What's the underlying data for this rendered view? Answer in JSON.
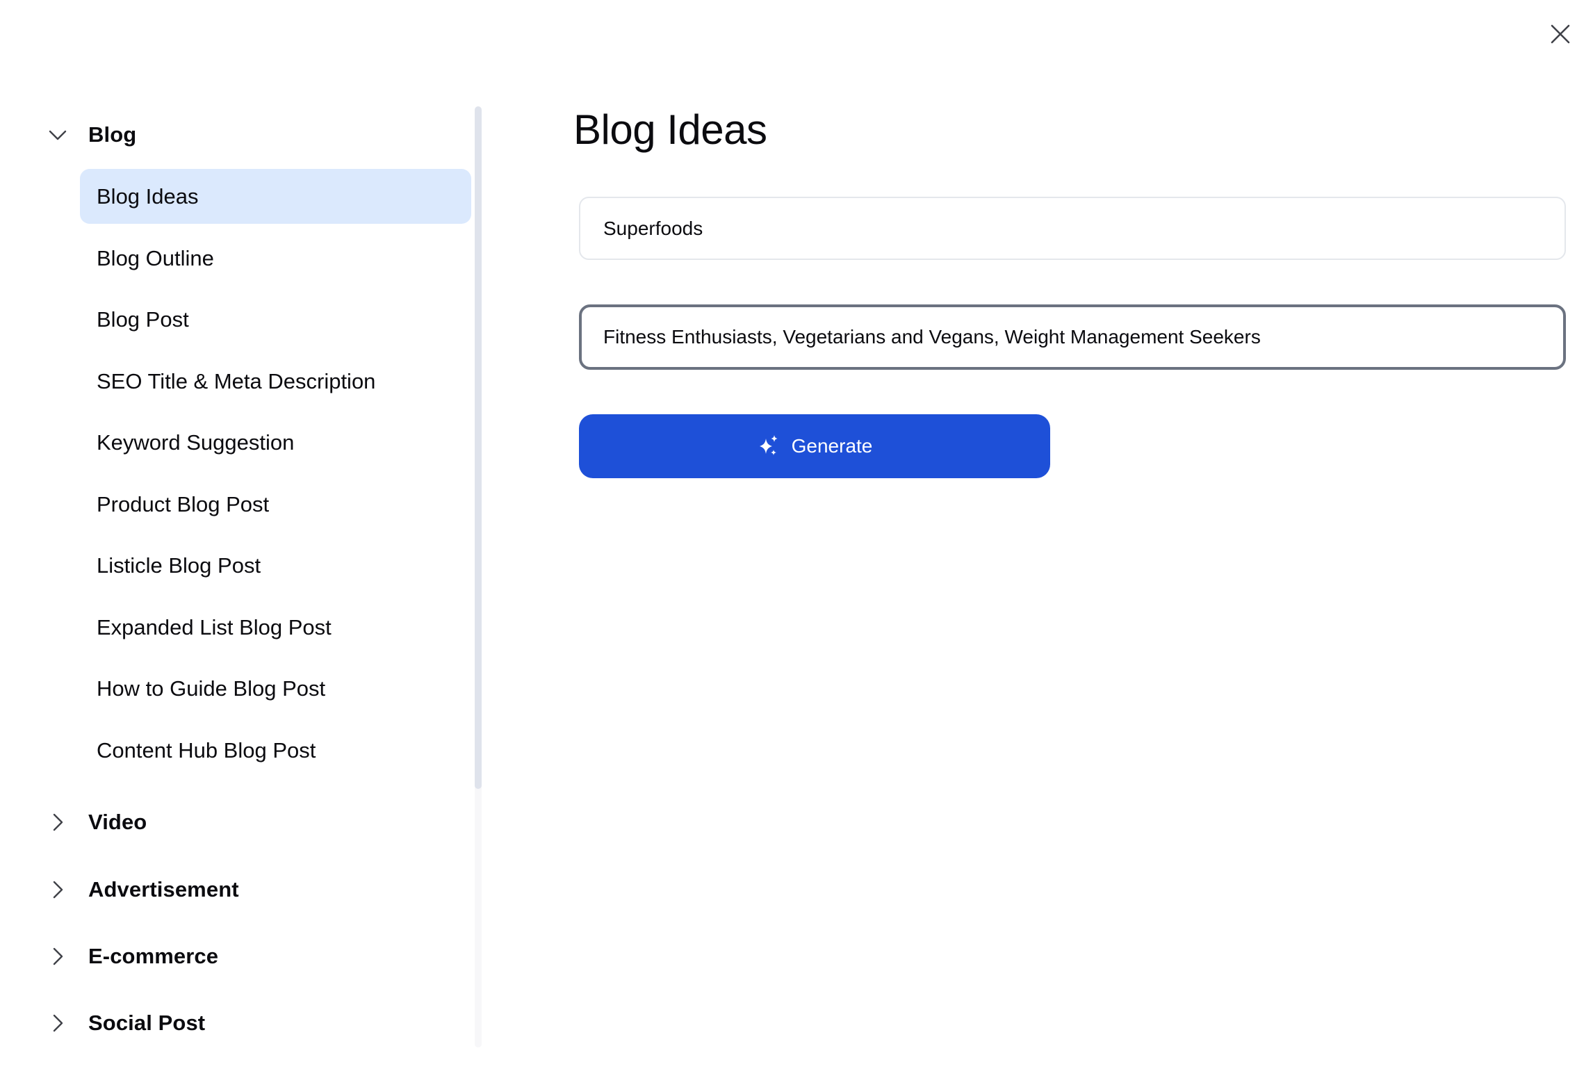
{
  "dialog": {
    "close_icon": "close-icon"
  },
  "sidebar": {
    "groups": [
      {
        "label": "Blog",
        "expanded": true,
        "icon": "chevron-down-icon",
        "items": [
          {
            "label": "Blog Ideas",
            "selected": true
          },
          {
            "label": "Blog Outline"
          },
          {
            "label": "Blog Post"
          },
          {
            "label": "SEO Title & Meta Description"
          },
          {
            "label": "Keyword Suggestion"
          },
          {
            "label": "Product Blog Post"
          },
          {
            "label": "Listicle Blog Post"
          },
          {
            "label": "Expanded List Blog Post"
          },
          {
            "label": "How to Guide Blog Post"
          },
          {
            "label": "Content Hub Blog Post"
          }
        ]
      },
      {
        "label": "Video",
        "expanded": false,
        "icon": "chevron-right-icon"
      },
      {
        "label": "Advertisement",
        "expanded": false,
        "icon": "chevron-right-icon"
      },
      {
        "label": "E-commerce",
        "expanded": false,
        "icon": "chevron-right-icon"
      },
      {
        "label": "Social Post",
        "expanded": false,
        "icon": "chevron-right-icon"
      }
    ]
  },
  "main": {
    "title": "Blog Ideas",
    "topic_field": {
      "value": "Superfoods"
    },
    "audience_field": {
      "value": "Fitness Enthusiasts, Vegetarians and Vegans, Weight Management Seekers",
      "focused": true
    },
    "generate_button": {
      "label": "Generate",
      "icon": "sparkles-icon"
    }
  },
  "colors": {
    "accent": "#1e50d8",
    "selected_bg": "#dbe9fd",
    "focus_border": "#6b7280",
    "field_border": "#e4e7ec"
  }
}
